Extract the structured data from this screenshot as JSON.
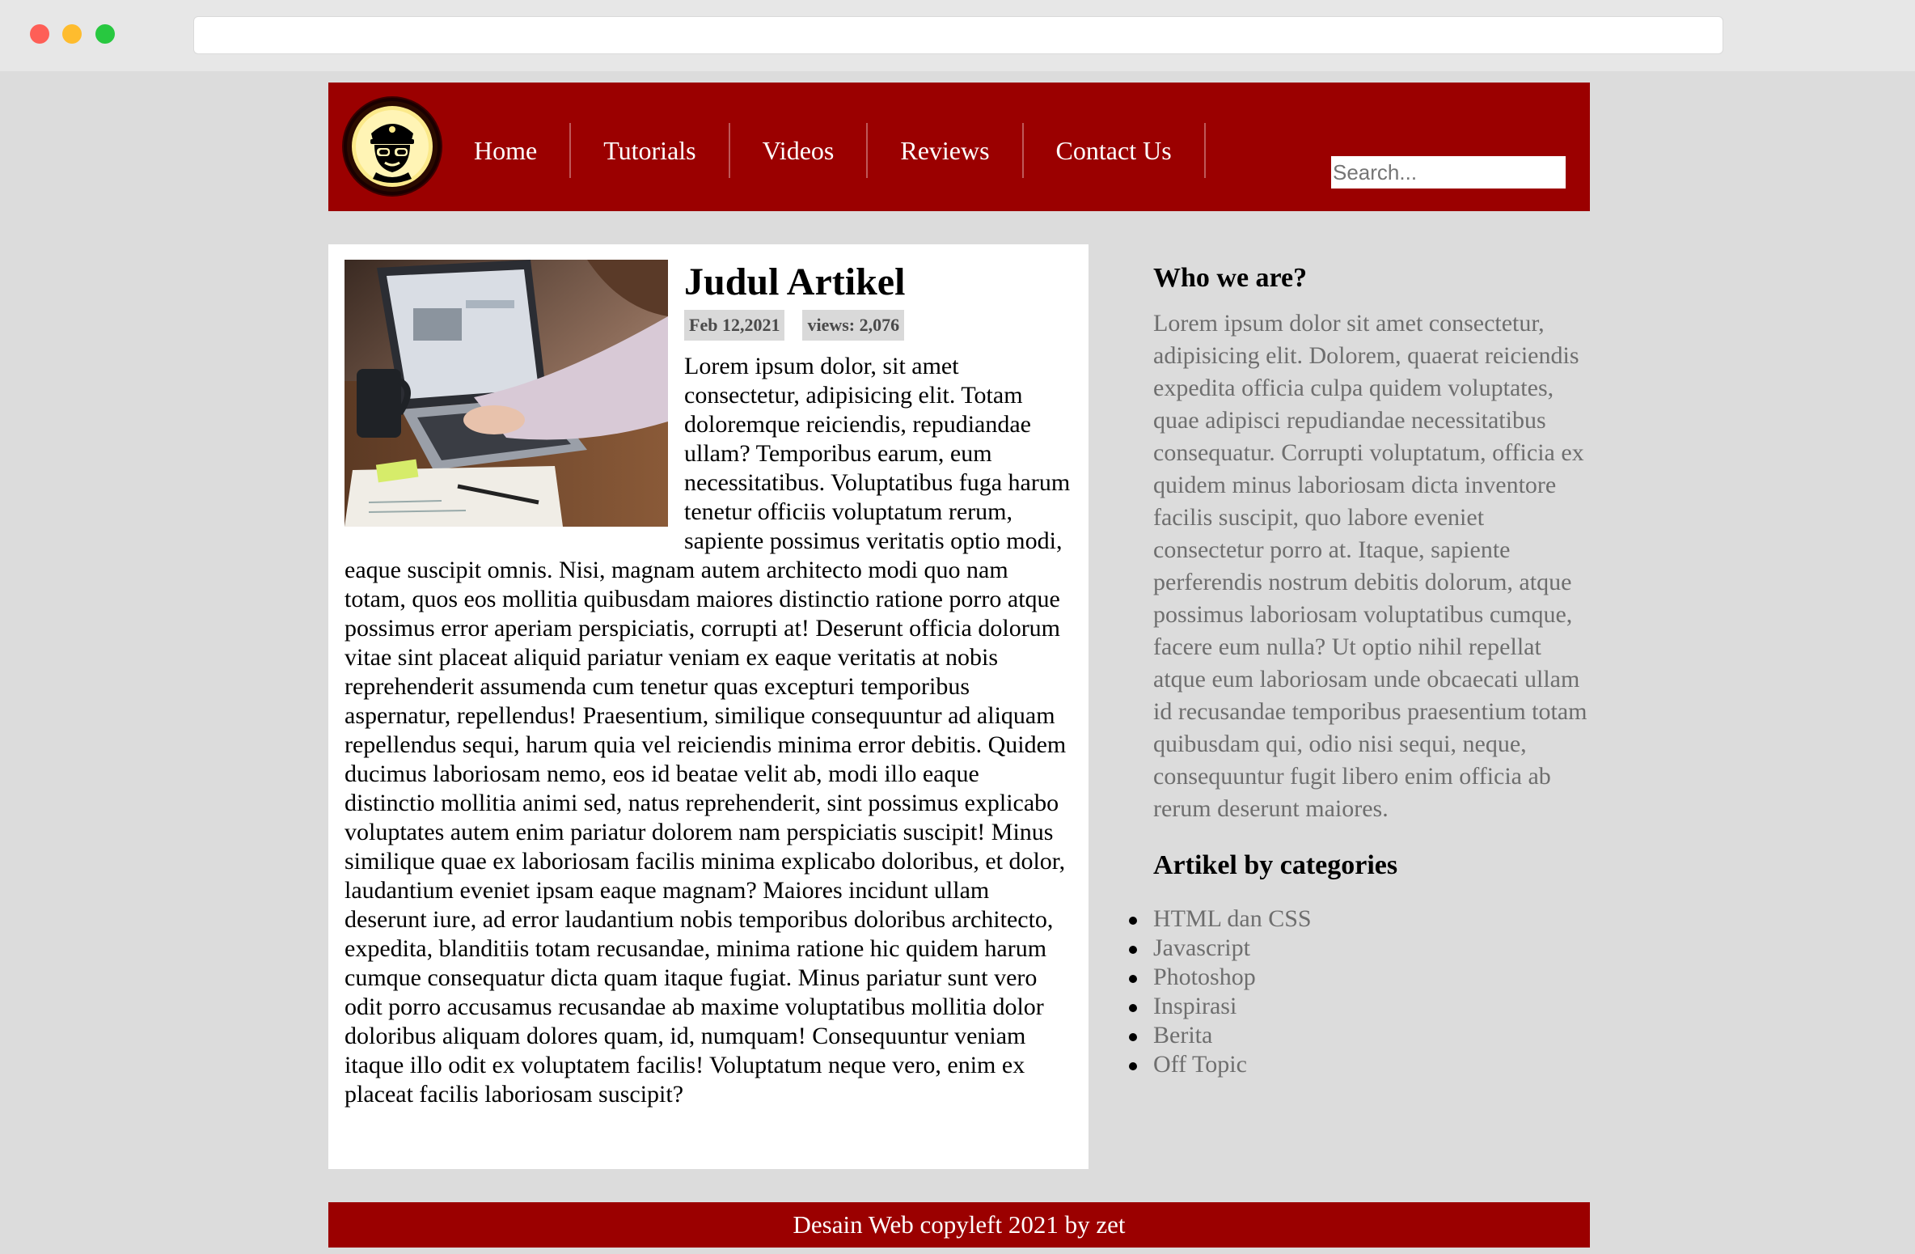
{
  "header": {
    "nav": [
      "Home",
      "Tutorials",
      "Videos",
      "Reviews",
      "Contact Us"
    ],
    "search_placeholder": "Search..."
  },
  "article": {
    "title": "Judul Artikel",
    "date": "Feb 12,2021",
    "views": "views: 2,076",
    "body": "Lorem ipsum dolor, sit amet consectetur, adipisicing elit. Totam doloremque reiciendis, repudiandae ullam? Temporibus earum, eum necessitatibus. Voluptatibus fuga harum tenetur officiis voluptatum rerum, sapiente possimus veritatis optio modi, eaque suscipit omnis. Nisi, magnam autem architecto modi quo nam totam, quos eos mollitia quibusdam maiores distinctio ratione porro atque possimus error aperiam perspiciatis, corrupti at! Deserunt officia dolorum vitae sint placeat aliquid pariatur veniam ex eaque veritatis at nobis reprehenderit assumenda cum tenetur quas excepturi temporibus aspernatur, repellendus! Praesentium, similique consequuntur ad aliquam repellendus sequi, harum quia vel reiciendis minima error debitis. Quidem ducimus laboriosam nemo, eos id beatae velit ab, modi illo eaque distinctio mollitia animi sed, natus reprehenderit, sint possimus explicabo voluptates autem enim pariatur dolorem nam perspiciatis suscipit! Minus similique quae ex laboriosam facilis minima explicabo doloribus, et dolor, laudantium eveniet ipsam eaque magnam? Maiores incidunt ullam deserunt iure, ad error laudantium nobis temporibus doloribus architecto, expedita, blanditiis totam recusandae, minima ratione hic quidem harum cumque consequatur dicta quam itaque fugiat. Minus pariatur sunt vero odit porro accusamus recusandae ab maxime voluptatibus mollitia dolor doloribus aliquam dolores quam, id, numquam! Consequuntur veniam itaque illo odit ex voluptatem facilis! Voluptatum neque vero, enim ex placeat facilis laboriosam suscipit?"
  },
  "sidebar": {
    "about_heading": "Who we are?",
    "about_text": "Lorem ipsum dolor sit amet consectetur, adipisicing elit. Dolorem, quaerat reiciendis expedita officia culpa quidem voluptates, quae adipisci repudiandae necessitatibus consequatur. Corrupti voluptatum, officia ex quidem minus laboriosam dicta inventore facilis suscipit, quo labore eveniet consectetur porro at. Itaque, sapiente perferendis nostrum debitis dolorum, atque possimus laboriosam voluptatibus cumque, facere eum nulla? Ut optio nihil repellat atque eum laboriosam unde obcaecati ullam id recusandae temporibus praesentium totam quibusdam qui, odio nisi sequi, neque, consequuntur fugit libero enim officia ab rerum deserunt maiores.",
    "categories_heading": "Artikel by categories",
    "categories": [
      "HTML dan CSS",
      "Javascript",
      "Photoshop",
      "Inspirasi",
      "Berita",
      "Off Topic"
    ]
  },
  "footer": {
    "text": "Desain Web copyleft 2021 by zet"
  },
  "colors": {
    "brand": "#9b0000",
    "background": "#dcdcdc",
    "muted_text": "#6e6e6e",
    "badge": "#d9d9d9"
  },
  "icons": {
    "logo": "police-officer-icon",
    "thumbnail": "laptop-photo"
  }
}
